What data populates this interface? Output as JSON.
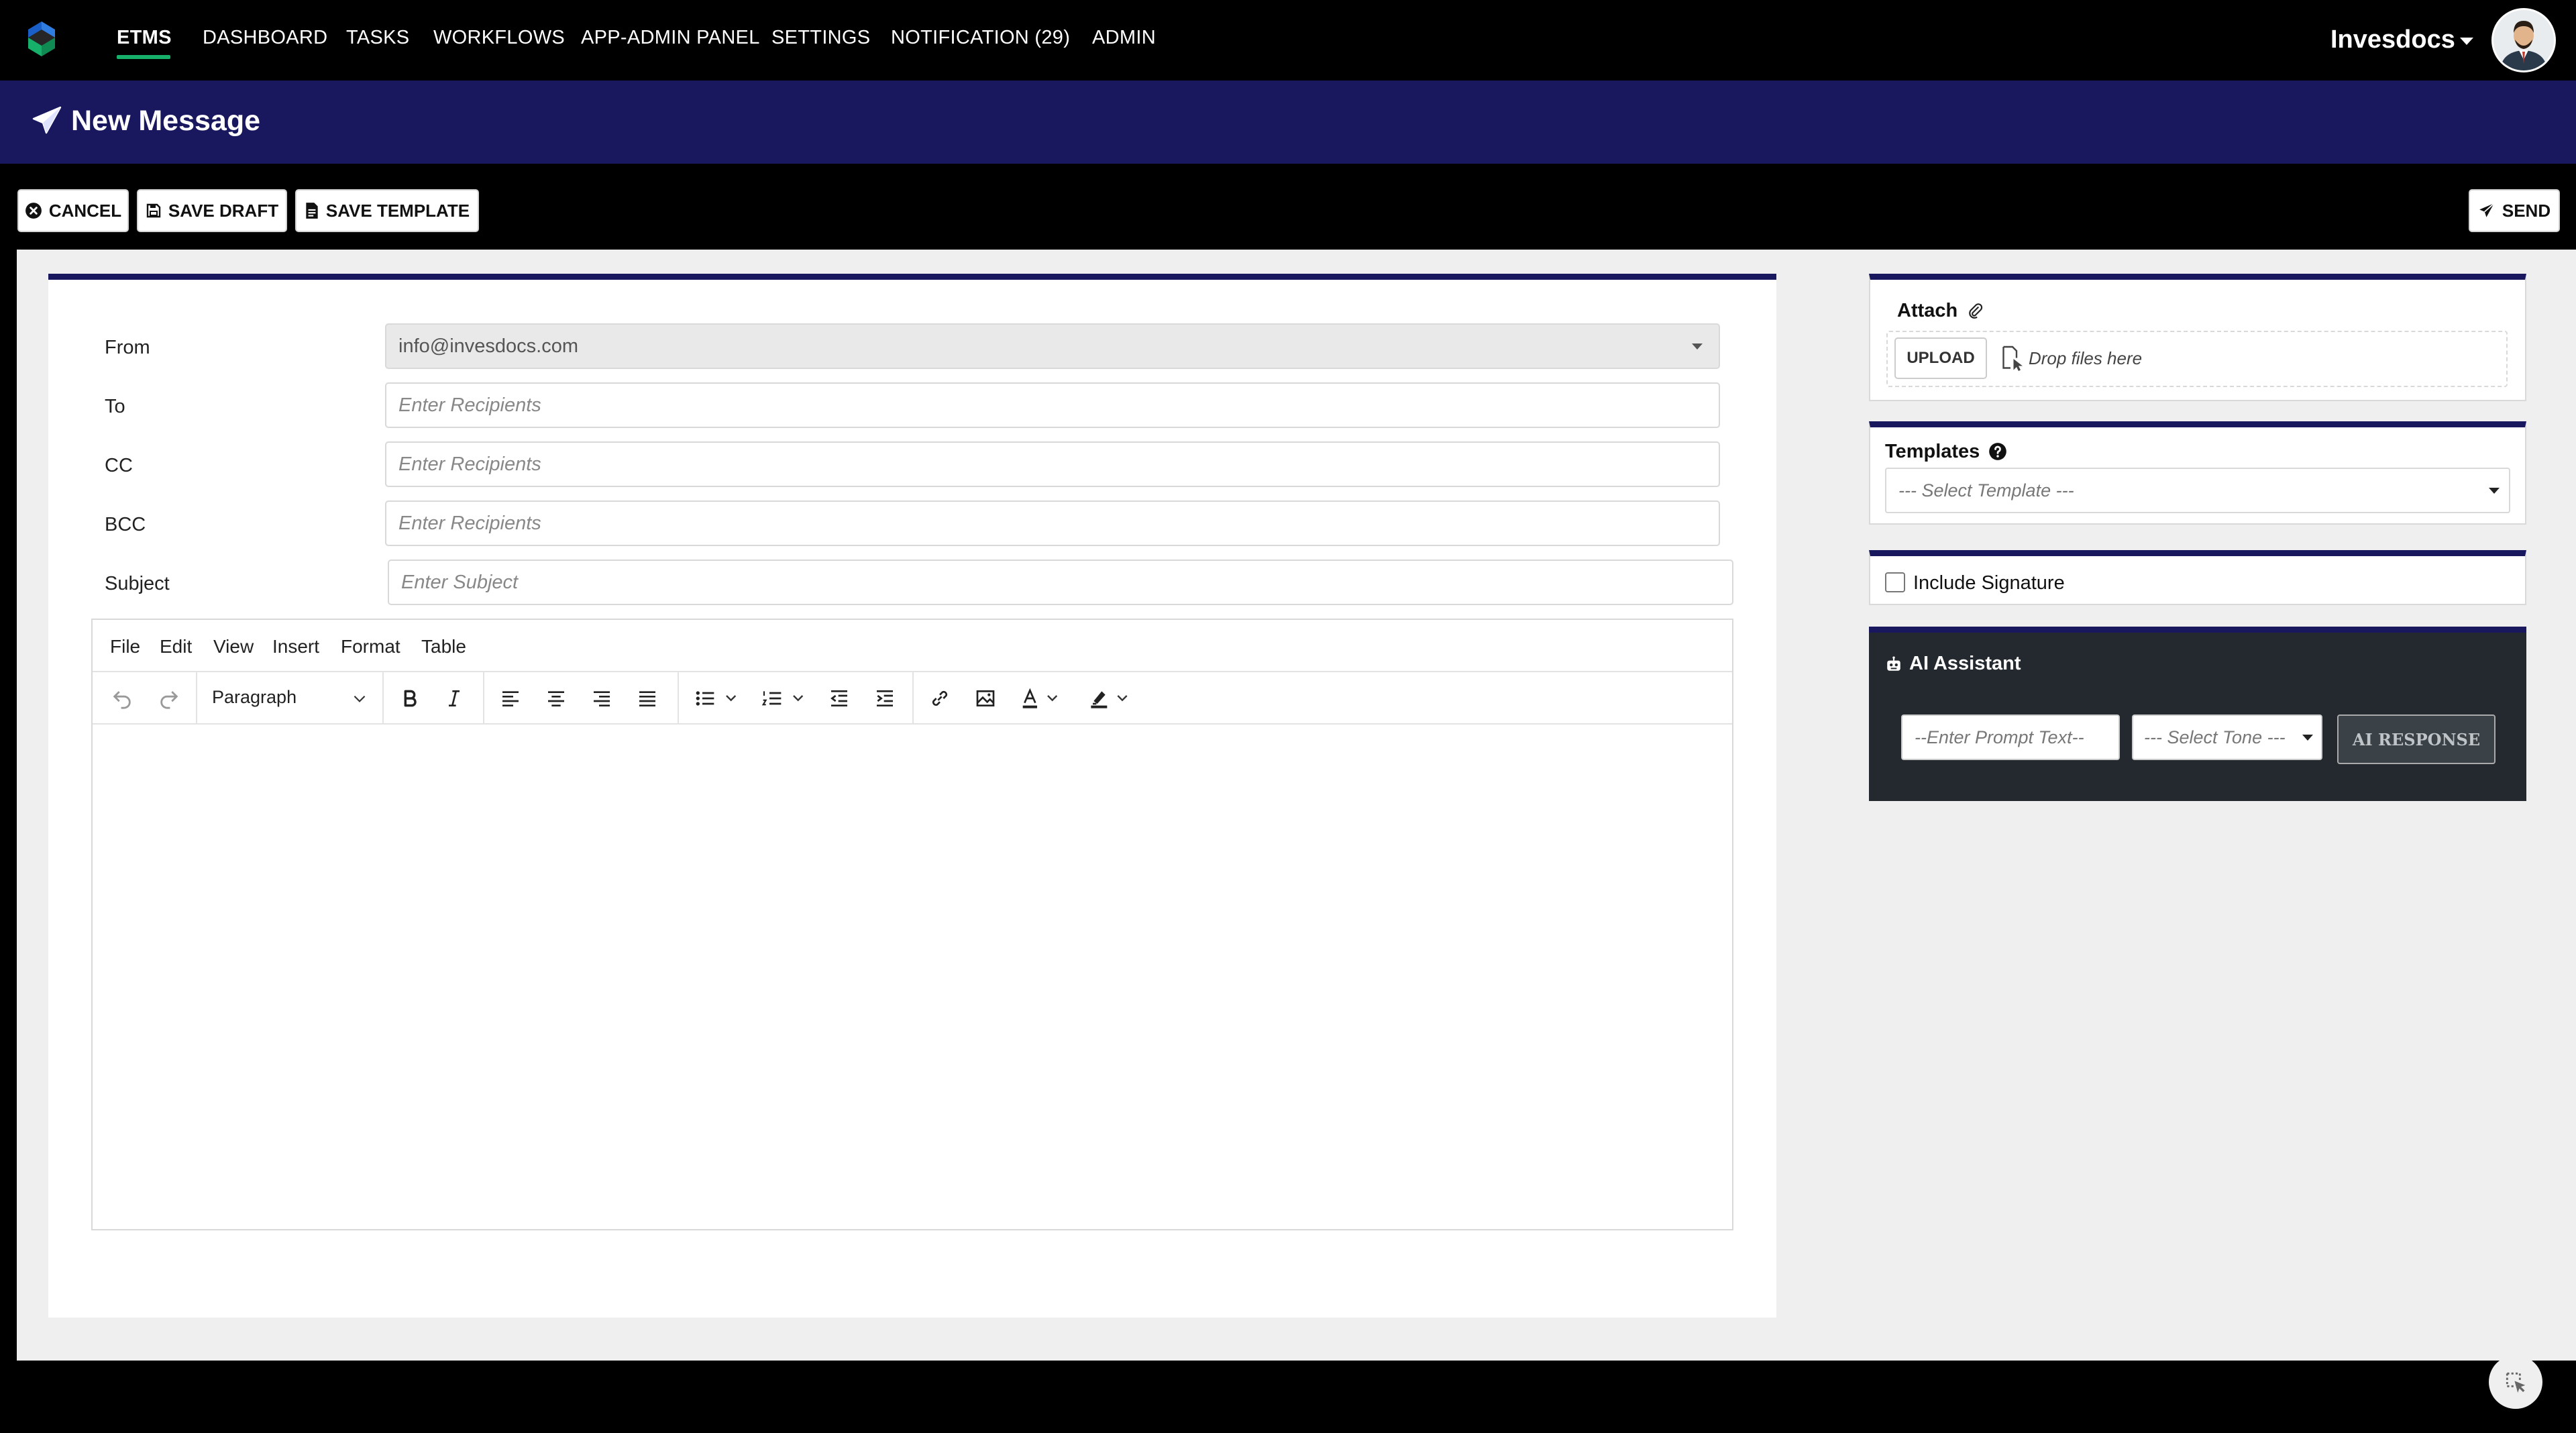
{
  "nav": {
    "items": [
      "ETMS",
      "DASHBOARD",
      "TASKS",
      "WORKFLOWS",
      "APP-ADMIN PANEL",
      "SETTINGS",
      "NOTIFICATION (29)",
      "ADMIN"
    ],
    "active_index": 0,
    "brand": "Invesdocs",
    "accent": "#16b06b"
  },
  "header": {
    "title": "New Message",
    "color": "#19185e"
  },
  "actions": {
    "cancel": "CANCEL",
    "save_draft": "SAVE DRAFT",
    "save_template": "SAVE TEMPLATE",
    "send": "SEND"
  },
  "form": {
    "from_label": "From",
    "from_value": "info@invesdocs.com",
    "to_label": "To",
    "to_placeholder": "Enter Recipients",
    "cc_label": "CC",
    "cc_placeholder": "Enter Recipients",
    "bcc_label": "BCC",
    "bcc_placeholder": "Enter Recipients",
    "subject_label": "Subject",
    "subject_placeholder": "Enter Subject"
  },
  "editor": {
    "menu": [
      "File",
      "Edit",
      "View",
      "Insert",
      "Format",
      "Table"
    ],
    "block_format": "Paragraph",
    "icons": [
      "undo-icon",
      "redo-icon",
      "bold-icon",
      "italic-icon",
      "align-left-icon",
      "align-center-icon",
      "align-right-icon",
      "align-justify-icon",
      "bullet-list-icon",
      "numbered-list-icon",
      "outdent-icon",
      "indent-icon",
      "link-icon",
      "image-icon",
      "text-color-icon",
      "highlight-icon"
    ]
  },
  "attach": {
    "title": "Attach",
    "upload": "UPLOAD",
    "drop": "Drop files here"
  },
  "templates": {
    "title": "Templates",
    "placeholder": "--- Select Template ---"
  },
  "signature": {
    "label": "Include Signature",
    "checked": false
  },
  "ai": {
    "title": "AI Assistant",
    "prompt_placeholder": "--Enter Prompt Text--",
    "tone_placeholder": "--- Select Tone ---",
    "button": "AI RESPONSE"
  }
}
